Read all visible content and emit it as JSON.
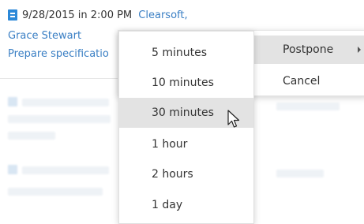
{
  "reminder": {
    "date_time": "9/28/2015 in 2:00 PM",
    "account": "Clearsoft,",
    "contact": "Grace Stewart",
    "subject": "Prepare specificatio",
    "icon": "document-icon"
  },
  "main_menu": {
    "items": [
      {
        "label": "Postpone",
        "has_submenu": true
      },
      {
        "label": "Cancel",
        "has_submenu": false
      }
    ]
  },
  "postpone_menu": {
    "items": [
      {
        "label": "5 minutes"
      },
      {
        "label": "10 minutes"
      },
      {
        "label": "30 minutes"
      },
      {
        "label": "1 hour"
      },
      {
        "label": "2 hours"
      },
      {
        "label": "1 day"
      }
    ],
    "hovered_index": 2
  },
  "colors": {
    "link": "#3a7fc4",
    "icon_blue": "#2b88d8",
    "hover_bg": "#e3e3e3"
  }
}
